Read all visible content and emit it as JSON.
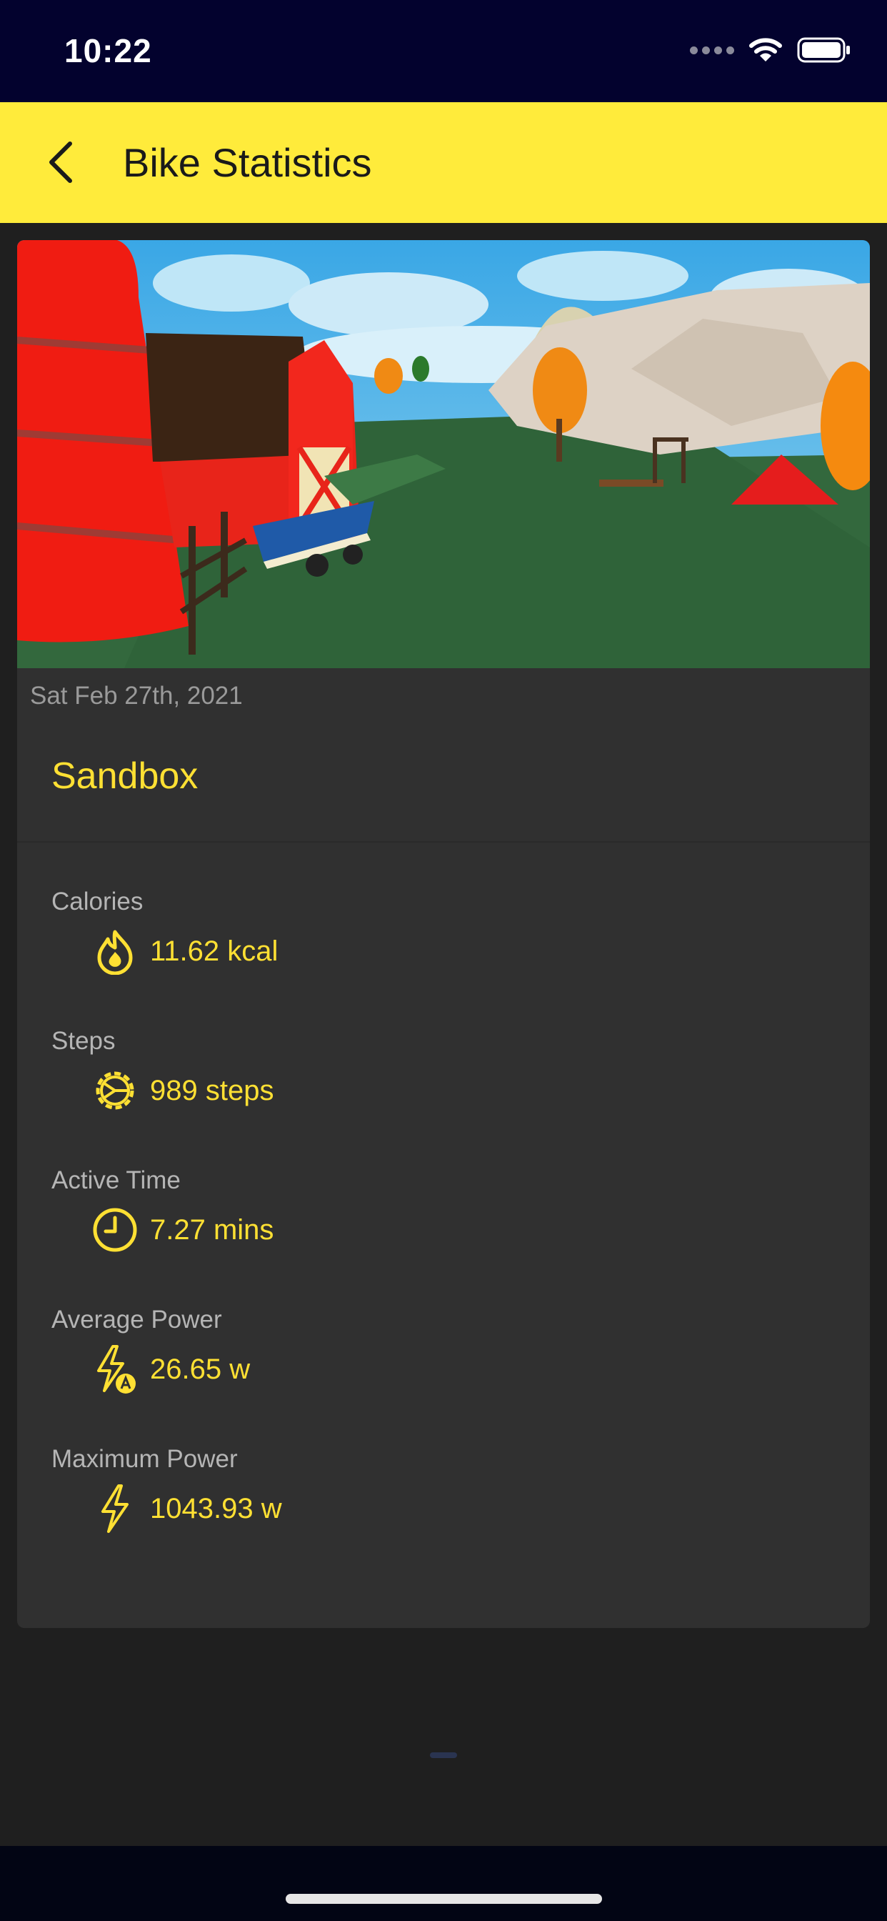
{
  "status_bar": {
    "time": "10:22"
  },
  "app_bar": {
    "title": "Bike Statistics"
  },
  "session": {
    "date": "Sat Feb 27th, 2021",
    "title": "Sandbox"
  },
  "stats": [
    {
      "label": "Calories",
      "value": "11.62 kcal",
      "icon": "flame-icon"
    },
    {
      "label": "Steps",
      "value": "989 steps",
      "icon": "gear-icon"
    },
    {
      "label": "Active Time",
      "value": "7.27 mins",
      "icon": "clock-icon"
    },
    {
      "label": "Average Power",
      "value": "26.65 w",
      "icon": "bolt-average-icon"
    },
    {
      "label": "Maximum Power",
      "value": "1043.93 w",
      "icon": "bolt-icon"
    }
  ],
  "colors": {
    "accent": "#ffeb3b",
    "value_text": "#ffe033",
    "card": "#303030",
    "background": "#1f1f1f",
    "status_bar": "#03022e"
  }
}
